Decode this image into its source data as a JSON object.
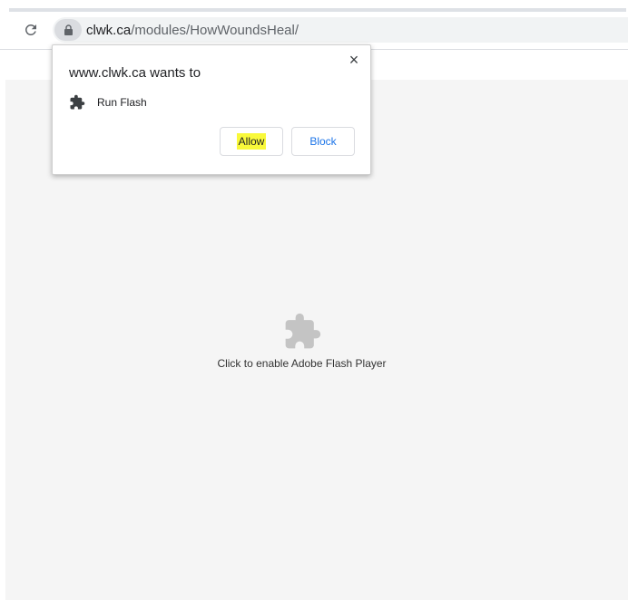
{
  "browser": {
    "url_domain": "clwk.ca",
    "url_path": "/modules/HowWoundsHeal/"
  },
  "permission_bubble": {
    "title": "www.clwk.ca wants to",
    "permission_label": "Run Flash",
    "allow_label": "Allow",
    "block_label": "Block",
    "close_glyph": "×",
    "highlight_color": "#f9f93a"
  },
  "page": {
    "plugin_message": "Click to enable Adobe Flash Player",
    "plugin_icon": "puzzle-piece-icon"
  },
  "icons": {
    "reload": "reload-icon",
    "lock": "lock-icon",
    "permission": "puzzle-piece-icon",
    "close": "close-icon"
  }
}
